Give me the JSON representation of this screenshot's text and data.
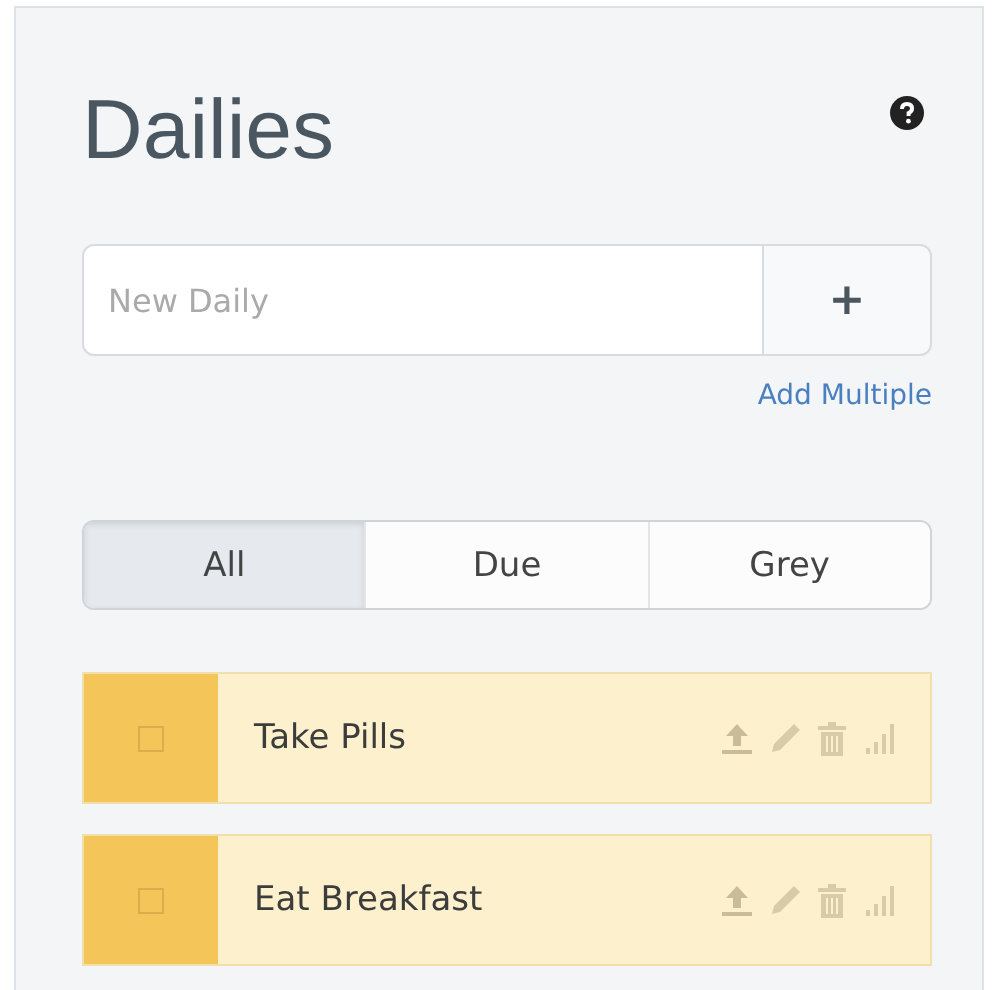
{
  "title": "Dailies",
  "new_task": {
    "placeholder": "New Daily",
    "add_label": "+",
    "add_multiple": "Add Multiple"
  },
  "tabs": [
    {
      "label": "All",
      "selected": true
    },
    {
      "label": "Due",
      "selected": false
    },
    {
      "label": "Grey",
      "selected": false
    }
  ],
  "tasks": [
    {
      "text": "Take Pills",
      "checked": false
    },
    {
      "text": "Eat Breakfast",
      "checked": false
    }
  ]
}
